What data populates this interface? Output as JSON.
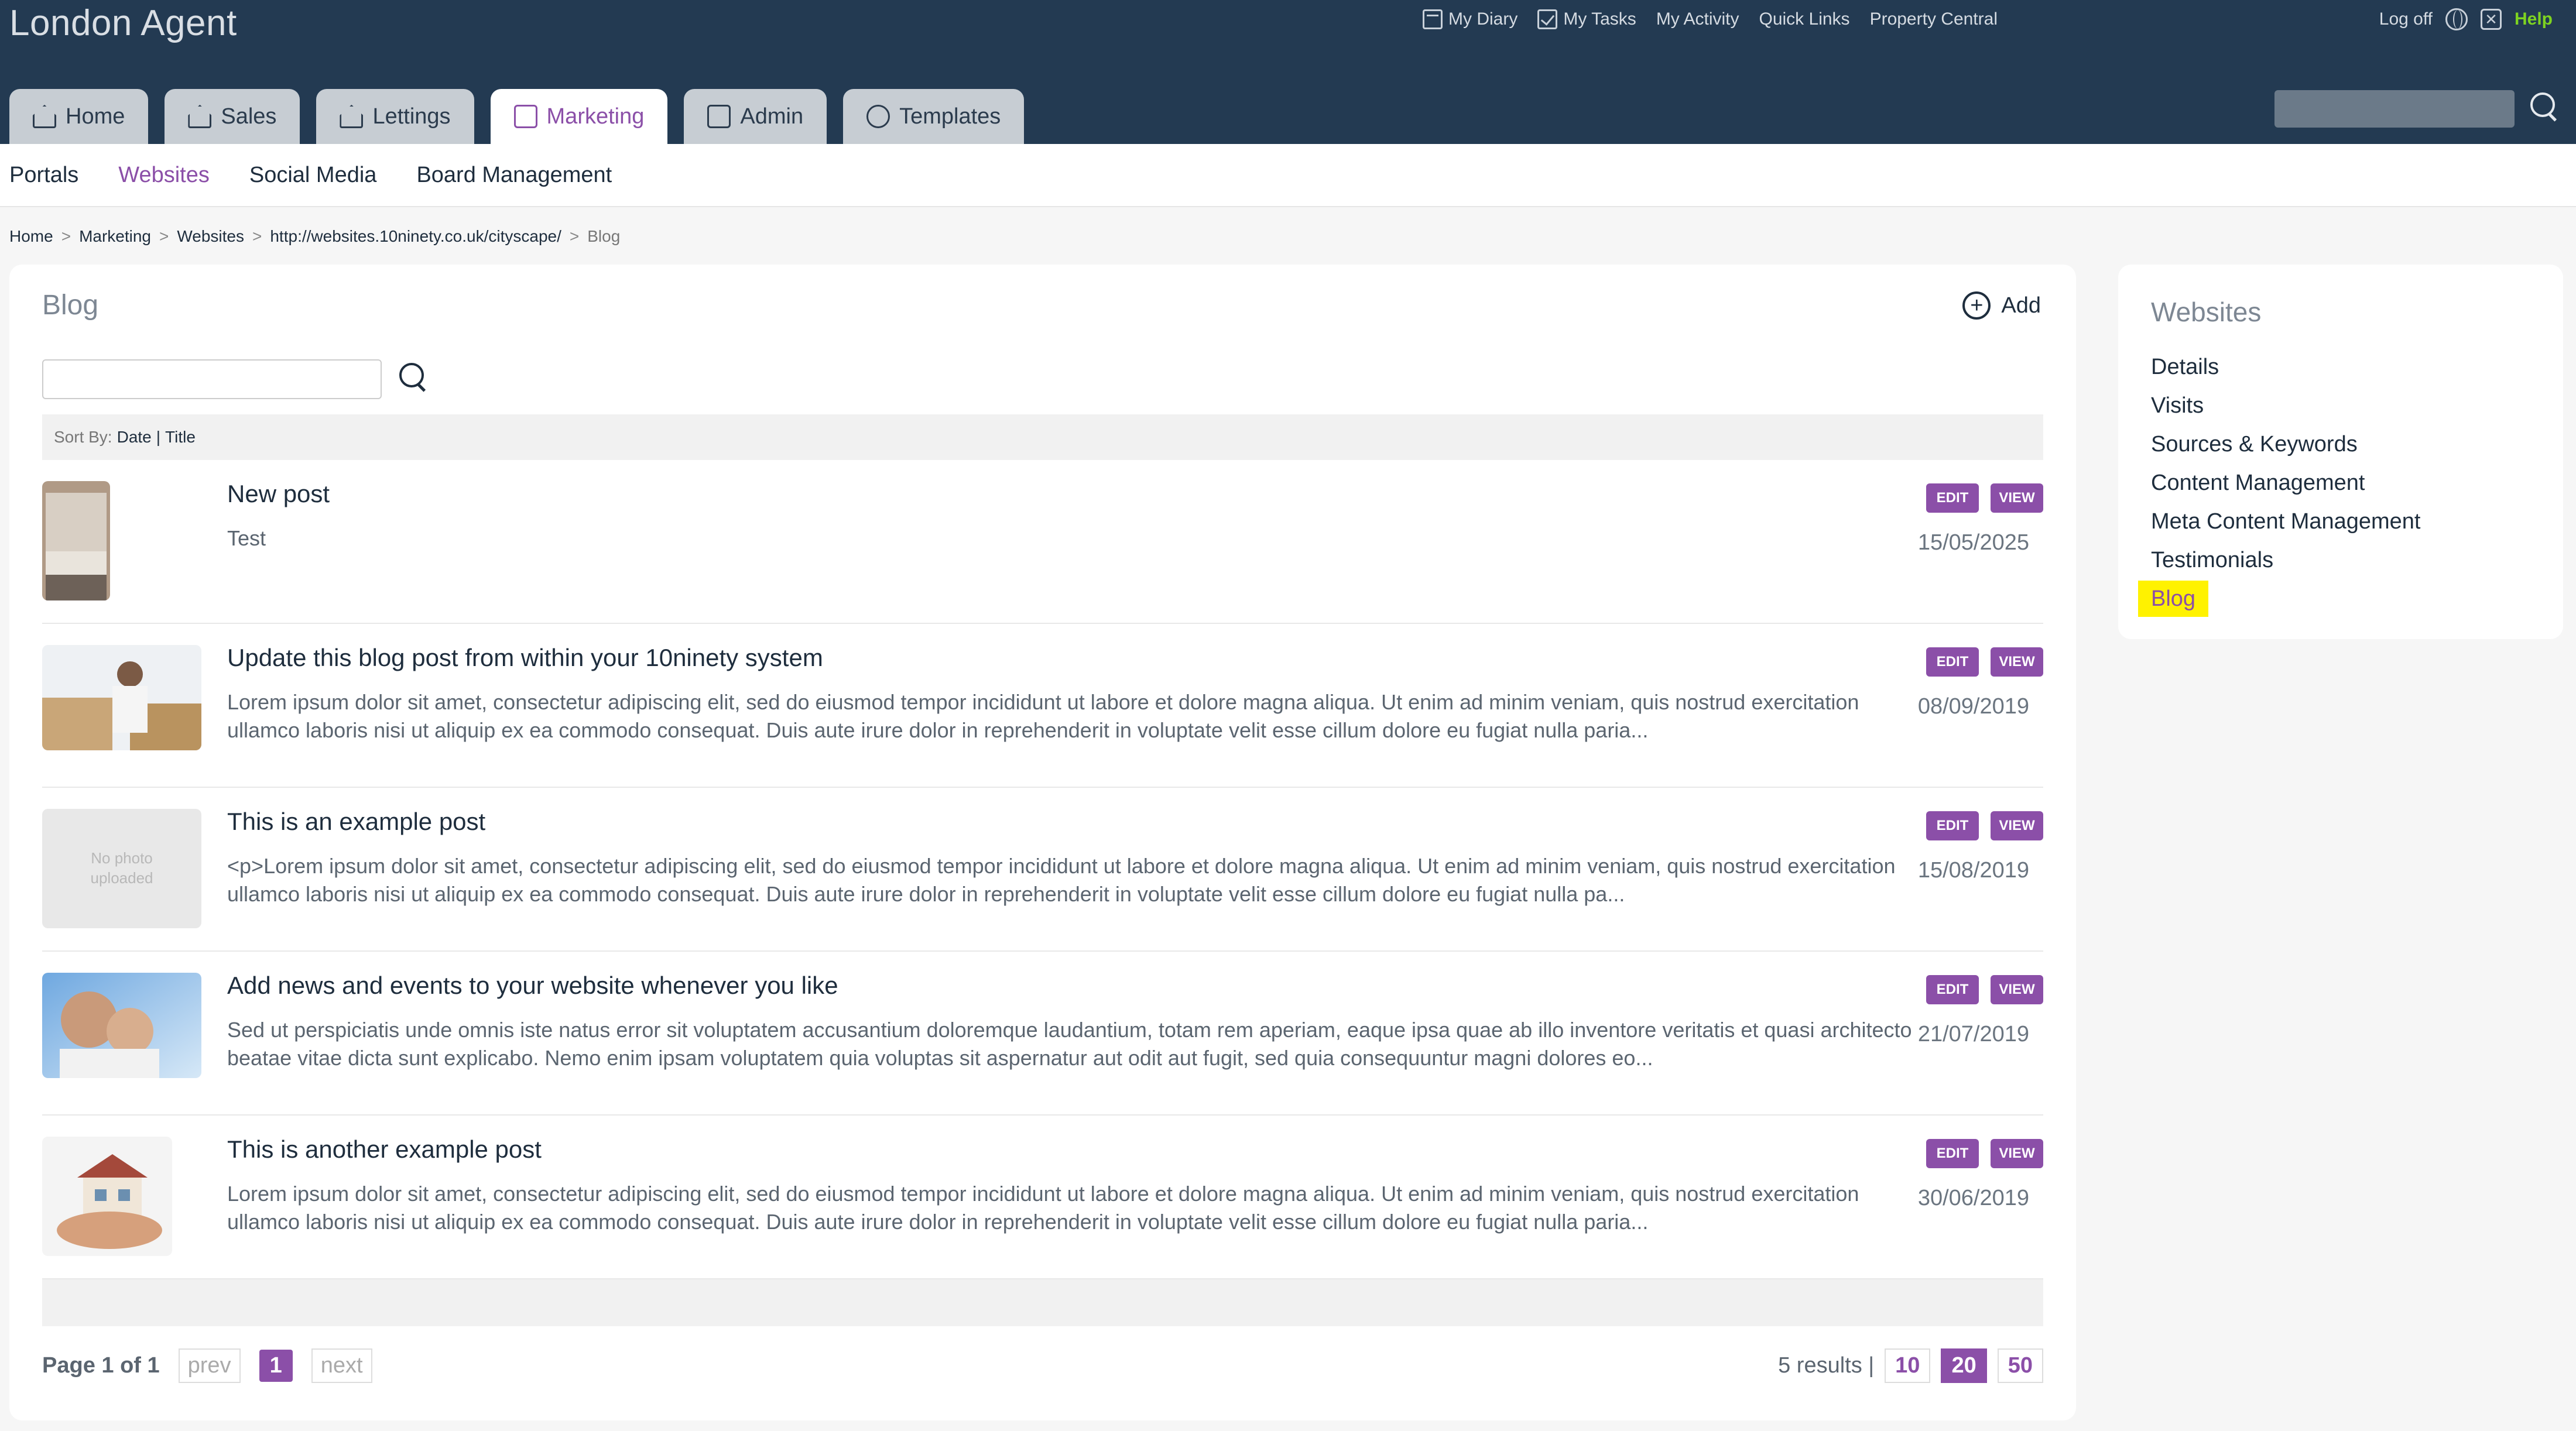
{
  "app": {
    "title": "London Agent"
  },
  "toplinks": {
    "diary": "My Diary",
    "tasks": "My Tasks",
    "activity": "My Activity",
    "quick_links": "Quick Links",
    "property_central": "Property Central"
  },
  "user_links": {
    "logoff": "Log off",
    "help": "Help"
  },
  "tabs": [
    {
      "label": "Home",
      "icon": "home-icon"
    },
    {
      "label": "Sales",
      "icon": "house-icon"
    },
    {
      "label": "Lettings",
      "icon": "house-key-icon"
    },
    {
      "label": "Marketing",
      "icon": "marketing-icon",
      "active": true
    },
    {
      "label": "Admin",
      "icon": "tools-icon"
    },
    {
      "label": "Templates",
      "icon": "templates-icon"
    }
  ],
  "subnav": [
    "Portals",
    "Websites",
    "Social Media",
    "Board Management"
  ],
  "breadcrumb": [
    "Home",
    "Marketing",
    "Websites",
    "http://websites.10ninety.co.uk/cityscape/",
    "Blog"
  ],
  "blog": {
    "title": "Blog",
    "add_label": "Add",
    "search_placeholder": "",
    "sort_label": "Sort By:",
    "sort_date": "Date",
    "sort_sep": "|",
    "sort_title": "Title",
    "edit_label": "EDIT",
    "view_label": "VIEW",
    "no_photo_text": "No photo uploaded",
    "posts": [
      {
        "title": "New post",
        "excerpt": "Test",
        "date": "15/05/2025",
        "thumb": "bedroom"
      },
      {
        "title": "Update this blog post from within your 10ninety system",
        "excerpt": "Lorem ipsum dolor sit amet, consectetur adipiscing elit, sed do eiusmod tempor incididunt ut labore et dolore magna aliqua. Ut enim ad minim veniam, quis nostrud exercitation ullamco laboris nisi ut aliquip ex ea commodo consequat. Duis aute irure dolor in reprehenderit in voluptate velit esse cillum dolore eu fugiat nulla paria...",
        "date": "08/09/2019",
        "thumb": "moving"
      },
      {
        "title": "This is an example post",
        "excerpt": "<p>Lorem ipsum dolor sit amet, consectetur adipiscing elit, sed do eiusmod tempor incididunt ut labore et dolore magna aliqua. Ut enim ad minim veniam, quis nostrud exercitation ullamco laboris nisi ut aliquip ex ea commodo consequat. Duis aute irure dolor in reprehenderit in voluptate velit esse cillum dolore eu fugiat nulla pa...",
        "date": "15/08/2019",
        "thumb": "none"
      },
      {
        "title": "Add news and events to your website whenever you like",
        "excerpt": "Sed ut perspiciatis unde omnis iste natus error sit voluptatem accusantium doloremque laudantium, totam rem aperiam, eaque ipsa quae ab illo inventore veritatis et quasi architecto beatae vitae dicta sunt explicabo. Nemo enim ipsam voluptatem quia voluptas sit aspernatur aut odit aut fugit, sed quia consequuntur magni dolores eo...",
        "date": "21/07/2019",
        "thumb": "couple"
      },
      {
        "title": "This is another example post",
        "excerpt": "Lorem ipsum dolor sit amet, consectetur adipiscing elit, sed do eiusmod tempor incididunt ut labore et dolore magna aliqua. Ut enim ad minim veniam, quis nostrud exercitation ullamco laboris nisi ut aliquip ex ea commodo consequat. Duis aute irure dolor in reprehenderit in voluptate velit esse cillum dolore eu fugiat nulla paria...",
        "date": "30/06/2019",
        "thumb": "house"
      }
    ]
  },
  "pagination": {
    "page_info": "Page 1 of 1",
    "prev": "prev",
    "current": "1",
    "next": "next",
    "results": "5 results |",
    "sizes": [
      "10",
      "20",
      "50"
    ],
    "active_size": "20"
  },
  "sidebar": {
    "title": "Websites",
    "items": [
      "Details",
      "Visits",
      "Sources & Keywords",
      "Content Management",
      "Meta Content Management",
      "Testimonials",
      "Blog"
    ],
    "active": "Blog"
  },
  "colors": {
    "header": "#233a52",
    "accent": "#8b4fa8",
    "highlight": "#fff200",
    "help": "#7ed321"
  }
}
